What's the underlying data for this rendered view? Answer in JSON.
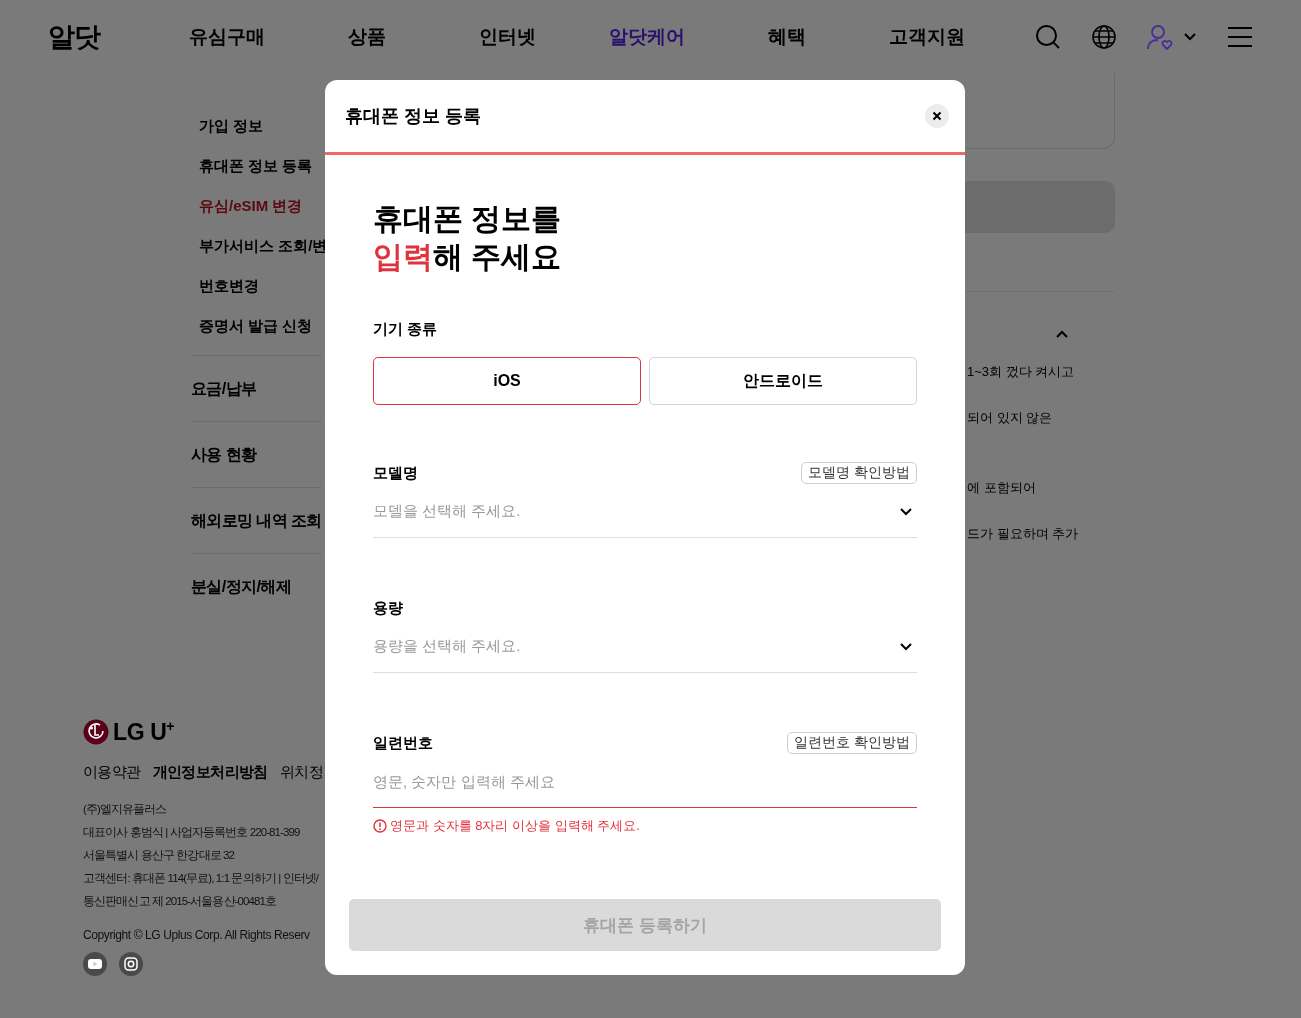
{
  "header": {
    "logo": "알닷",
    "nav": [
      {
        "label": "유심구매",
        "selected": false
      },
      {
        "label": "상품",
        "selected": false
      },
      {
        "label": "인터넷",
        "selected": false
      },
      {
        "label": "알닷케어",
        "selected": true
      },
      {
        "label": "혜택",
        "selected": false
      },
      {
        "label": "고객지원",
        "selected": false
      }
    ]
  },
  "sidebar": {
    "items": [
      {
        "label": "가입 정보",
        "selected": false
      },
      {
        "label": "휴대폰 정보 등록",
        "selected": false
      },
      {
        "label": "유심/eSIM 변경",
        "selected": true
      },
      {
        "label": "부가서비스 조회/변",
        "selected": false
      },
      {
        "label": "번호변경",
        "selected": false
      },
      {
        "label": "증명서 발급 신청",
        "selected": false
      }
    ],
    "sections": [
      "요금/납부",
      "사용 현황",
      "해외로밍 내역 조회",
      "분실/정지/해제"
    ]
  },
  "content_fragments": [
    "1~3회 껐다 켜시고",
    "되어 있지 않은",
    "에 포함되어",
    "드가 필요하며 추가"
  ],
  "footer": {
    "logo": "LG U",
    "logo_sup": "+",
    "links": [
      "이용약관",
      "개인정보처리방침",
      "위치정"
    ],
    "company_lines": [
      "(주)엘지유플러스",
      "대표이사 홍범식 | 사업자등록번호 220-81-399",
      "서울특별시 용산구 한강대로 32",
      "고객센터: 휴대폰 114(무료), 1:1 문의하기 | 인터넷/",
      "통신판매신고 제 2015-서울용산-00481호"
    ],
    "copyright": "Copyright © LG Uplus Corp. All Rights Reserv"
  },
  "modal": {
    "title": "휴대폰 정보 등록",
    "heading": {
      "line1": "휴대폰 정보를",
      "highlight": "입력",
      "rest": "해 주세요"
    },
    "device_label": "기기 종류",
    "device_options": [
      {
        "label": "iOS",
        "selected": true
      },
      {
        "label": "안드로이드",
        "selected": false
      }
    ],
    "fields": [
      {
        "kind": "select",
        "label": "모델명",
        "help": "모델명 확인방법",
        "placeholder": "모델을 선택해 주세요.",
        "invalid": false
      },
      {
        "kind": "select",
        "label": "용량",
        "placeholder": "용량을 선택해 주세요.",
        "invalid": false
      },
      {
        "kind": "input",
        "label": "일련번호",
        "help": "일련번호 확인방법",
        "placeholder": "영문, 숫자만 입력해 주세요",
        "invalid": true,
        "error": "영문과 숫자를 8자리 이상을 입력해 주세요."
      }
    ],
    "submit": {
      "label": "휴대폰 등록하기",
      "disabled": true
    }
  }
}
